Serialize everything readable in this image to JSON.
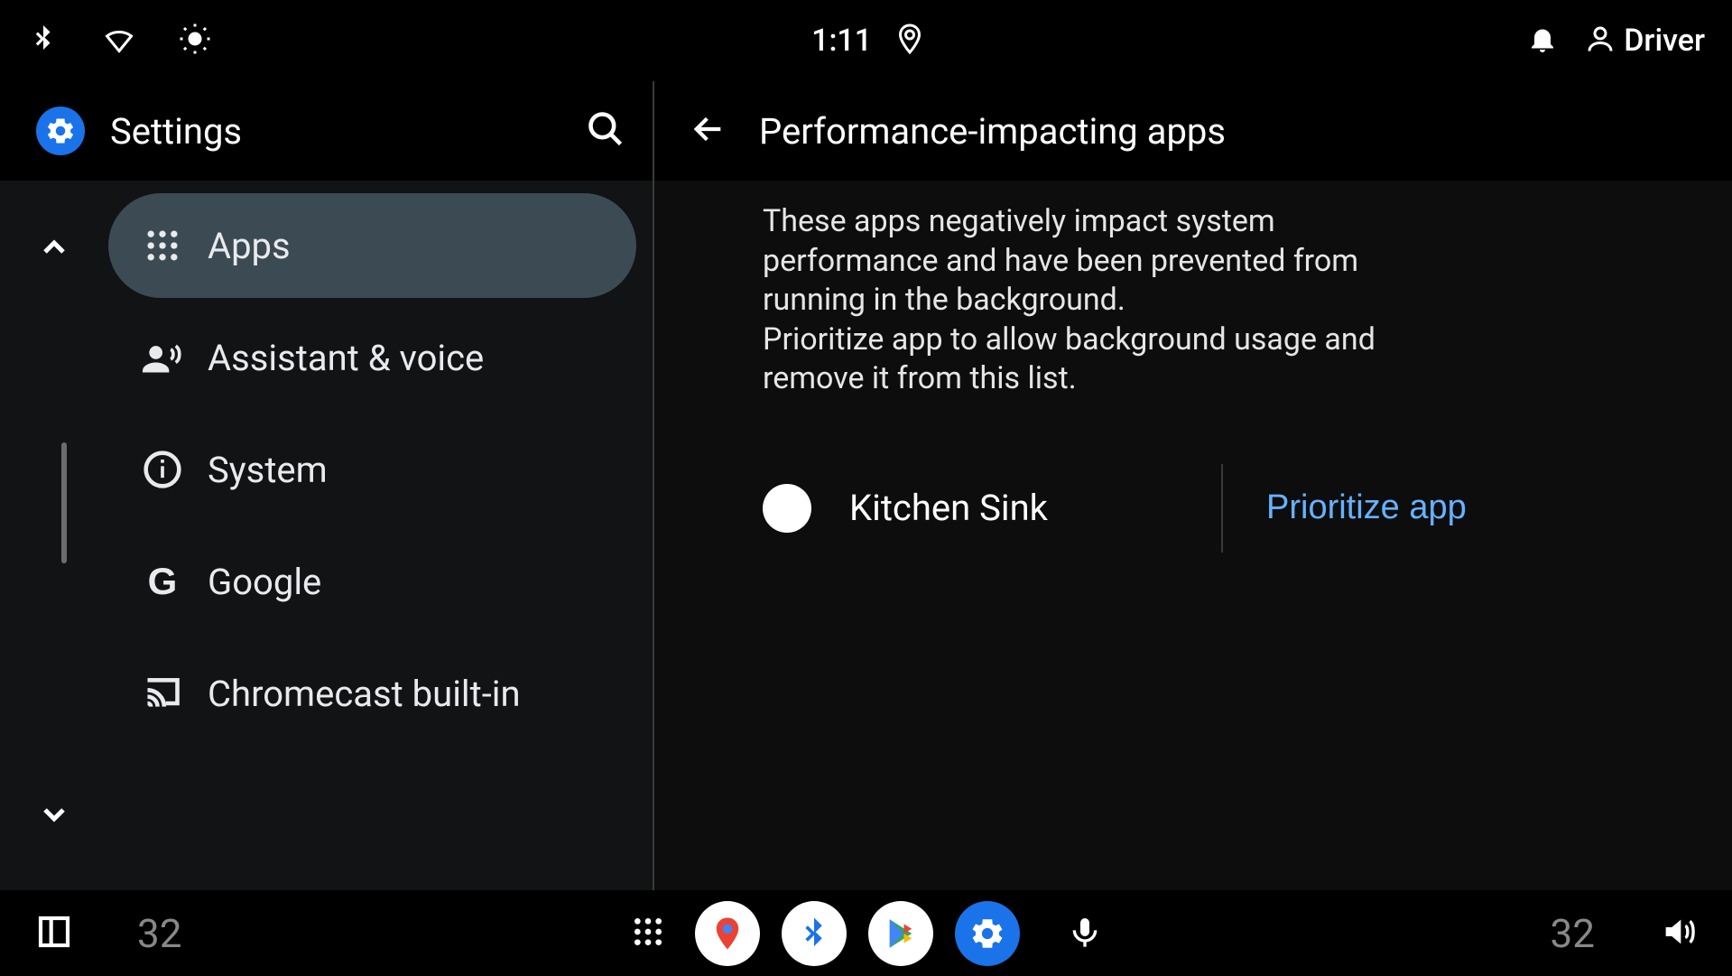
{
  "status": {
    "time": "1:11",
    "user_label": "Driver"
  },
  "sidebar": {
    "title": "Settings",
    "items": [
      {
        "label": "Apps",
        "selected": true
      },
      {
        "label": "Assistant & voice",
        "selected": false
      },
      {
        "label": "System",
        "selected": false
      },
      {
        "label": "Google",
        "selected": false
      },
      {
        "label": "Chromecast built-in",
        "selected": false
      }
    ]
  },
  "detail": {
    "title": "Performance-impacting apps",
    "description": "These apps negatively impact system performance and have been prevented from running in the background.\nPrioritize app to allow background usage and remove it from this list.",
    "apps": [
      {
        "name": "Kitchen Sink",
        "action_label": "Prioritize app"
      }
    ]
  },
  "bottom": {
    "temperature_left": "32",
    "temperature_right": "32"
  }
}
